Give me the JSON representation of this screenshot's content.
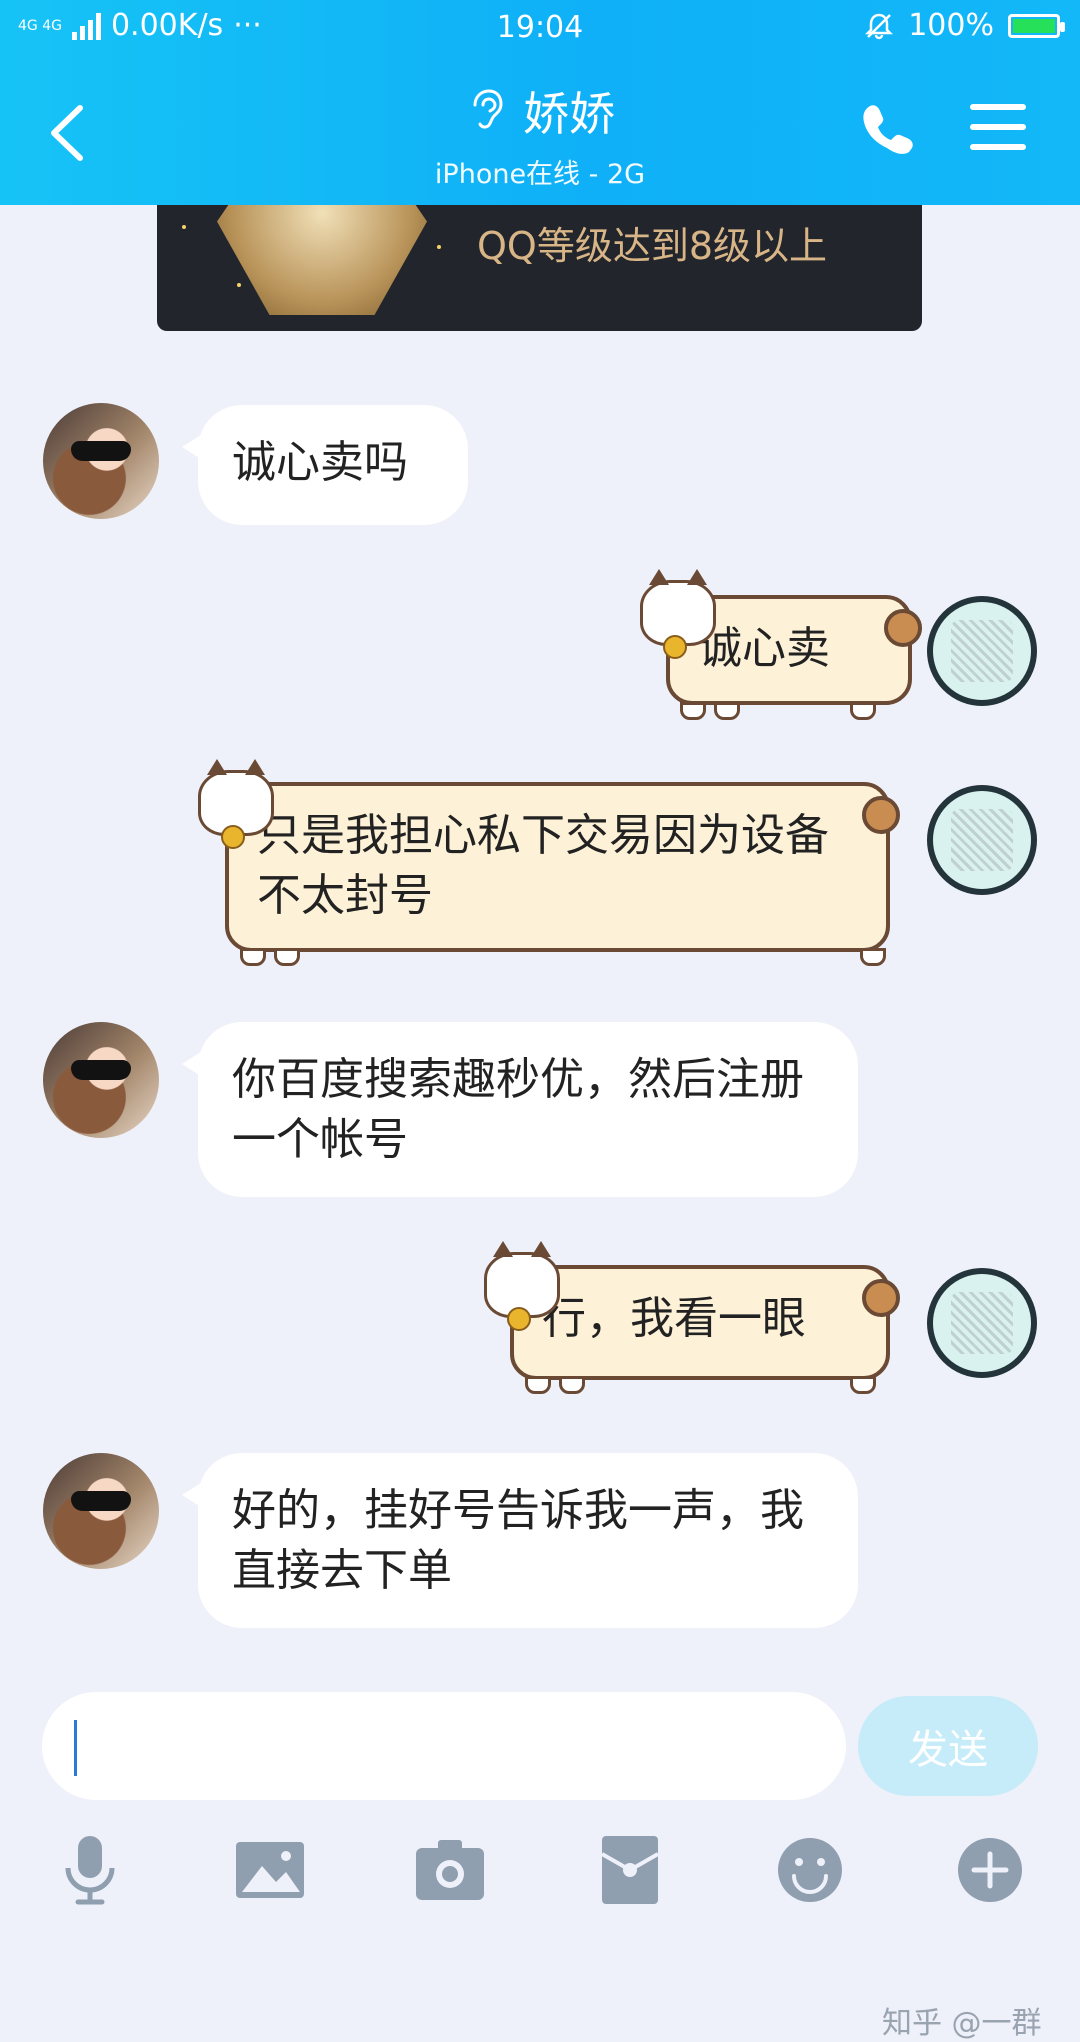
{
  "status_bar": {
    "network_badge": "4G 4G",
    "speed": "0.00K/s",
    "more": "···",
    "time": "19:04",
    "battery": "100%",
    "battery_level": 1.0
  },
  "header": {
    "title": "娇娇",
    "subtitle": "iPhone在线 - 2G"
  },
  "banner": {
    "text": "QQ等级达到8级以上"
  },
  "messages": [
    {
      "from": "her",
      "text": "诚心卖吗"
    },
    {
      "from": "me",
      "text": "诚心卖"
    },
    {
      "from": "me",
      "text": "只是我担心私下交易因为设备不太封号"
    },
    {
      "from": "her",
      "text": "你百度搜索趣秒优，然后注册一个帐号"
    },
    {
      "from": "me",
      "text": "行，我看一眼"
    },
    {
      "from": "her",
      "text": "好的，挂好号告诉我一声，我直接去下单"
    }
  ],
  "composer": {
    "placeholder": "",
    "send_label": "发送"
  },
  "toolbar_icons": [
    "microphone-icon",
    "image-icon",
    "camera-icon",
    "red-packet-icon",
    "emoji-icon",
    "plus-icon"
  ],
  "watermark": "知乎 @一群",
  "colors": {
    "header_blue": "#12b8f8",
    "background": "#eef1f9",
    "send_button": "#c7ecf9",
    "outgoing_bubble": "#fdf1d7"
  }
}
